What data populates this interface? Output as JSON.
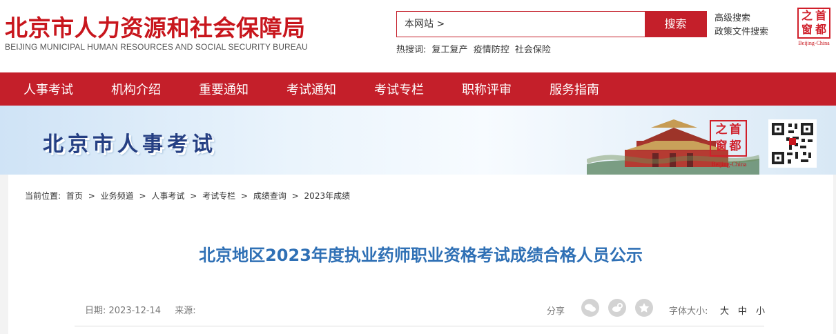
{
  "header": {
    "title": "北京市人力资源和社会保障局",
    "subtitle": "BEIJING MUNICIPAL HUMAN RESOURCES AND SOCIAL SECURITY BUREAU",
    "search_scope": "本网站 >",
    "search_button": "搜索",
    "hot_search_label": "热搜词:",
    "hot_terms": [
      "复工复产",
      "疫情防控",
      "社会保险"
    ],
    "advanced_search": "高级搜索",
    "policy_search": "政策文件搜索"
  },
  "logo": {
    "characters": [
      "之",
      "首",
      "窗",
      "都"
    ],
    "text": "Beijing-China"
  },
  "navigation": [
    "人事考试",
    "机构介绍",
    "重要通知",
    "考试通知",
    "考试专栏",
    "职称评审",
    "服务指南"
  ],
  "banner": {
    "title": "北京市人事考试"
  },
  "breadcrumb": {
    "label": "当前位置:",
    "items": [
      "首页",
      ">",
      "业务频道",
      ">",
      "人事考试",
      ">",
      "考试专栏",
      ">",
      "成绩查询",
      ">",
      "2023年成绩"
    ]
  },
  "article": {
    "title": "北京地区2023年度执业药师职业资格考试成绩合格人员公示",
    "date_label": "日期:",
    "date": "2023-12-14",
    "source_label": "来源:",
    "share_label": "分享",
    "font_size_label": "字体大小:",
    "font_sizes": [
      "大",
      "中",
      "小"
    ]
  },
  "icons": {
    "wechat": "wechat-icon",
    "weibo": "weibo-icon",
    "favorite": "star-icon",
    "qr": "qr-code-icon"
  },
  "colors": {
    "primary_red": "#c41f2a",
    "title_blue": "#2f70b5",
    "banner_blue": "#253f83"
  }
}
